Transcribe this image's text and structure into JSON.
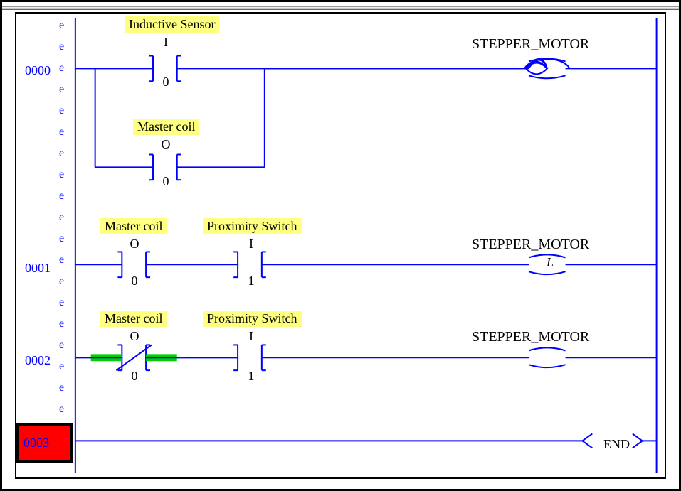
{
  "rungs": {
    "r0_num": "0000",
    "r1_num": "0001",
    "r2_num": "0002",
    "r3_num": "0003"
  },
  "gutter_char": "e",
  "rung0": {
    "contact_a_tag": "Inductive Sensor",
    "contact_a_type": "I",
    "contact_a_addr": "0",
    "contact_b_tag": "Master coil",
    "contact_b_type": "O",
    "contact_b_addr": "0",
    "output_label": "STEPPER_MOTOR"
  },
  "rung1": {
    "contact_a_tag": "Master coil",
    "contact_a_type": "O",
    "contact_a_addr": "0",
    "contact_b_tag": "Proximity Switch",
    "contact_b_type": "I",
    "contact_b_addr": "1",
    "output_label": "STEPPER_MOTOR",
    "coil_letter": "L"
  },
  "rung2": {
    "contact_a_tag": "Master coil",
    "contact_a_type": "O",
    "contact_a_addr": "0",
    "contact_b_tag": "Proximity Switch",
    "contact_b_type": "I",
    "contact_b_addr": "1",
    "output_label": "STEPPER_MOTOR"
  },
  "rung3": {
    "end_label": "END"
  }
}
